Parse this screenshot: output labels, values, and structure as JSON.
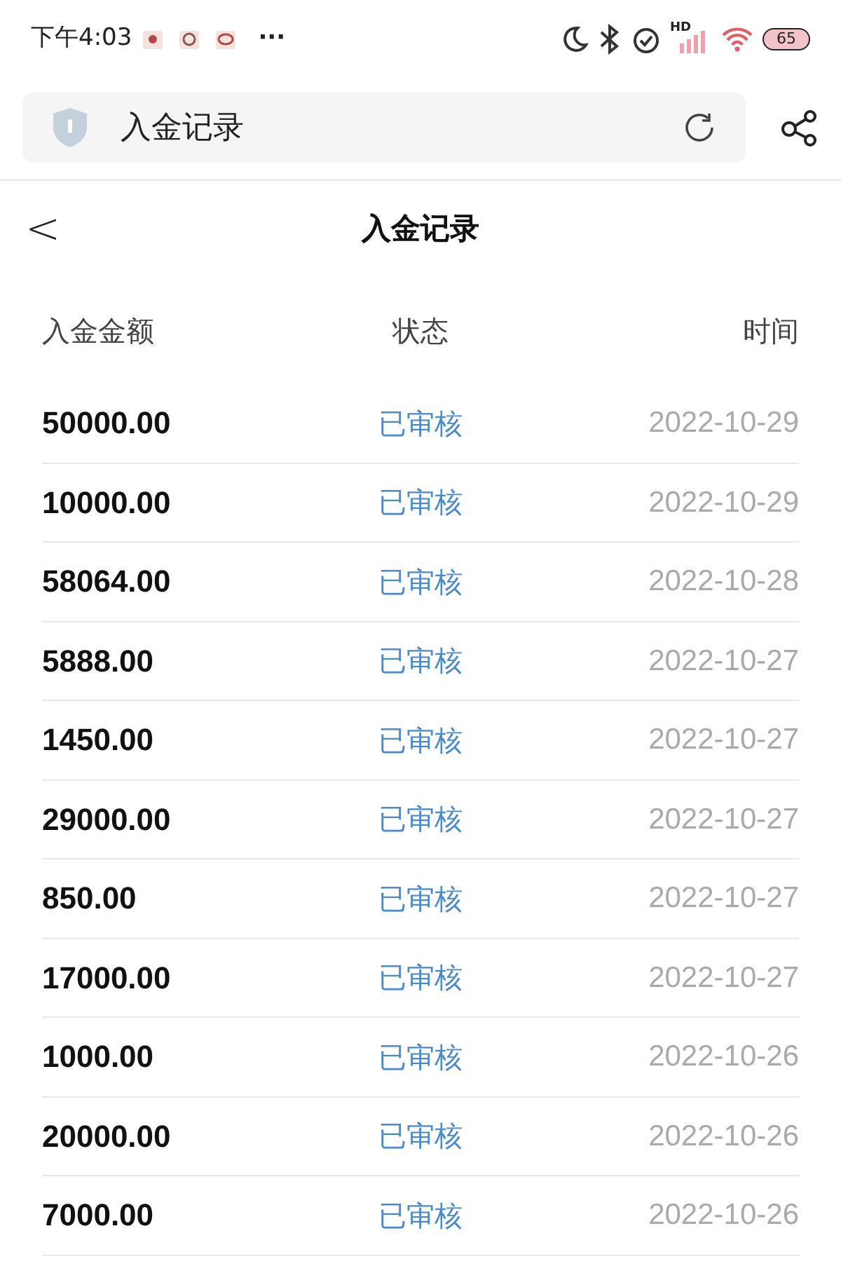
{
  "status_bar": {
    "time": "下午4:03",
    "more": "···",
    "network": "HD",
    "battery": "65"
  },
  "address_bar": {
    "title": "入金记录"
  },
  "header": {
    "back": "<",
    "title": "入金记录"
  },
  "table": {
    "columns": [
      "入金金额",
      "状态",
      "时间"
    ],
    "rows": [
      {
        "amount": "50000.00",
        "status": "已审核",
        "date": "2022-10-29"
      },
      {
        "amount": "10000.00",
        "status": "已审核",
        "date": "2022-10-29"
      },
      {
        "amount": "58064.00",
        "status": "已审核",
        "date": "2022-10-28"
      },
      {
        "amount": "5888.00",
        "status": "已审核",
        "date": "2022-10-27"
      },
      {
        "amount": "1450.00",
        "status": "已审核",
        "date": "2022-10-27"
      },
      {
        "amount": "29000.00",
        "status": "已审核",
        "date": "2022-10-27"
      },
      {
        "amount": "850.00",
        "status": "已审核",
        "date": "2022-10-27"
      },
      {
        "amount": "17000.00",
        "status": "已审核",
        "date": "2022-10-27"
      },
      {
        "amount": "1000.00",
        "status": "已审核",
        "date": "2022-10-26"
      },
      {
        "amount": "20000.00",
        "status": "已审核",
        "date": "2022-10-26"
      },
      {
        "amount": "7000.00",
        "status": "已审核",
        "date": "2022-10-26"
      }
    ]
  }
}
